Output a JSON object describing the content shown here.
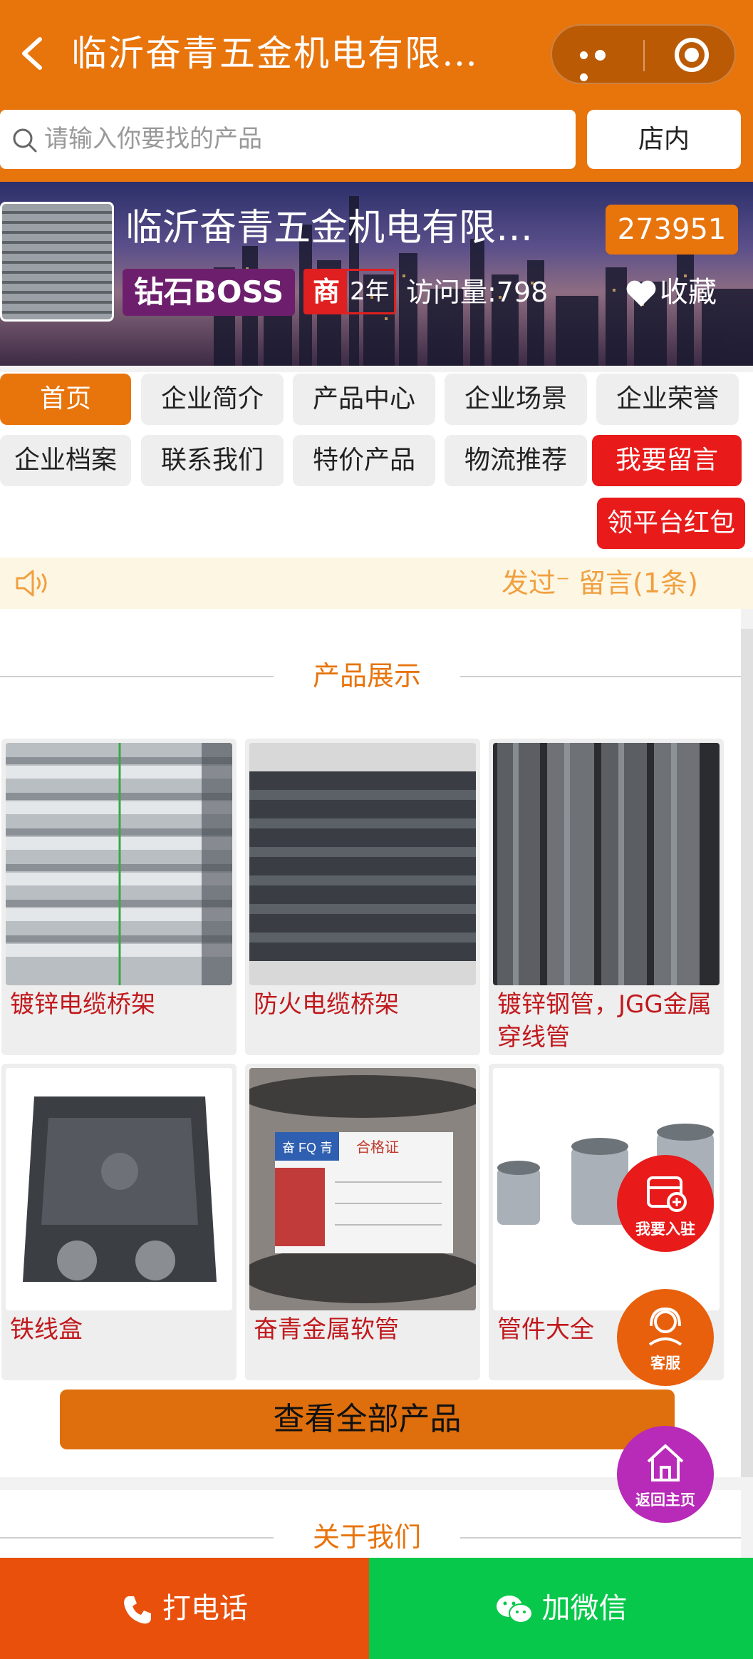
{
  "header": {
    "title": "临沂奋青五金机电有限…"
  },
  "search": {
    "placeholder": "请输入你要找的产品",
    "scope_button": "店内"
  },
  "store": {
    "name": "临沂奋青五金机电有限…",
    "code": "273951",
    "boss_badge": "钻石BOSS",
    "shang_badge": "商",
    "years": "2年",
    "visits": "访问量:798",
    "favorite": "收藏"
  },
  "nav": {
    "items": [
      {
        "label": "首页"
      },
      {
        "label": "企业简介"
      },
      {
        "label": "产品中心"
      },
      {
        "label": "企业场景"
      },
      {
        "label": "企业荣誉"
      },
      {
        "label": "企业档案"
      },
      {
        "label": "联系我们"
      },
      {
        "label": "特价产品"
      },
      {
        "label": "物流推荐"
      },
      {
        "label": "我要留言"
      }
    ],
    "red_packet": "领平台红包"
  },
  "notice": {
    "text": "发过⁻  留言(1条)"
  },
  "products": {
    "section_title": "产品展示",
    "items": [
      {
        "name": "镀锌电缆桥架"
      },
      {
        "name": "防火电缆桥架"
      },
      {
        "name": "镀锌钢管，JGG金属穿线管"
      },
      {
        "name": "铁线盒"
      },
      {
        "name": "奋青金属软管"
      },
      {
        "name": "管件大全"
      }
    ],
    "view_all": "查看全部产品",
    "hose_label_title": "合格证",
    "hose_brand": "奋 FQ 青"
  },
  "about": {
    "section_title": "关于我们"
  },
  "floating": {
    "join": "我要入驻",
    "service": "客服",
    "home": "返回主页"
  },
  "bottom": {
    "call": "打电话",
    "wechat": "加微信"
  },
  "colors": {
    "brand_orange": "#e8740c",
    "red": "#e81a1a",
    "green": "#07c84a",
    "purple": "#b82ab8"
  }
}
